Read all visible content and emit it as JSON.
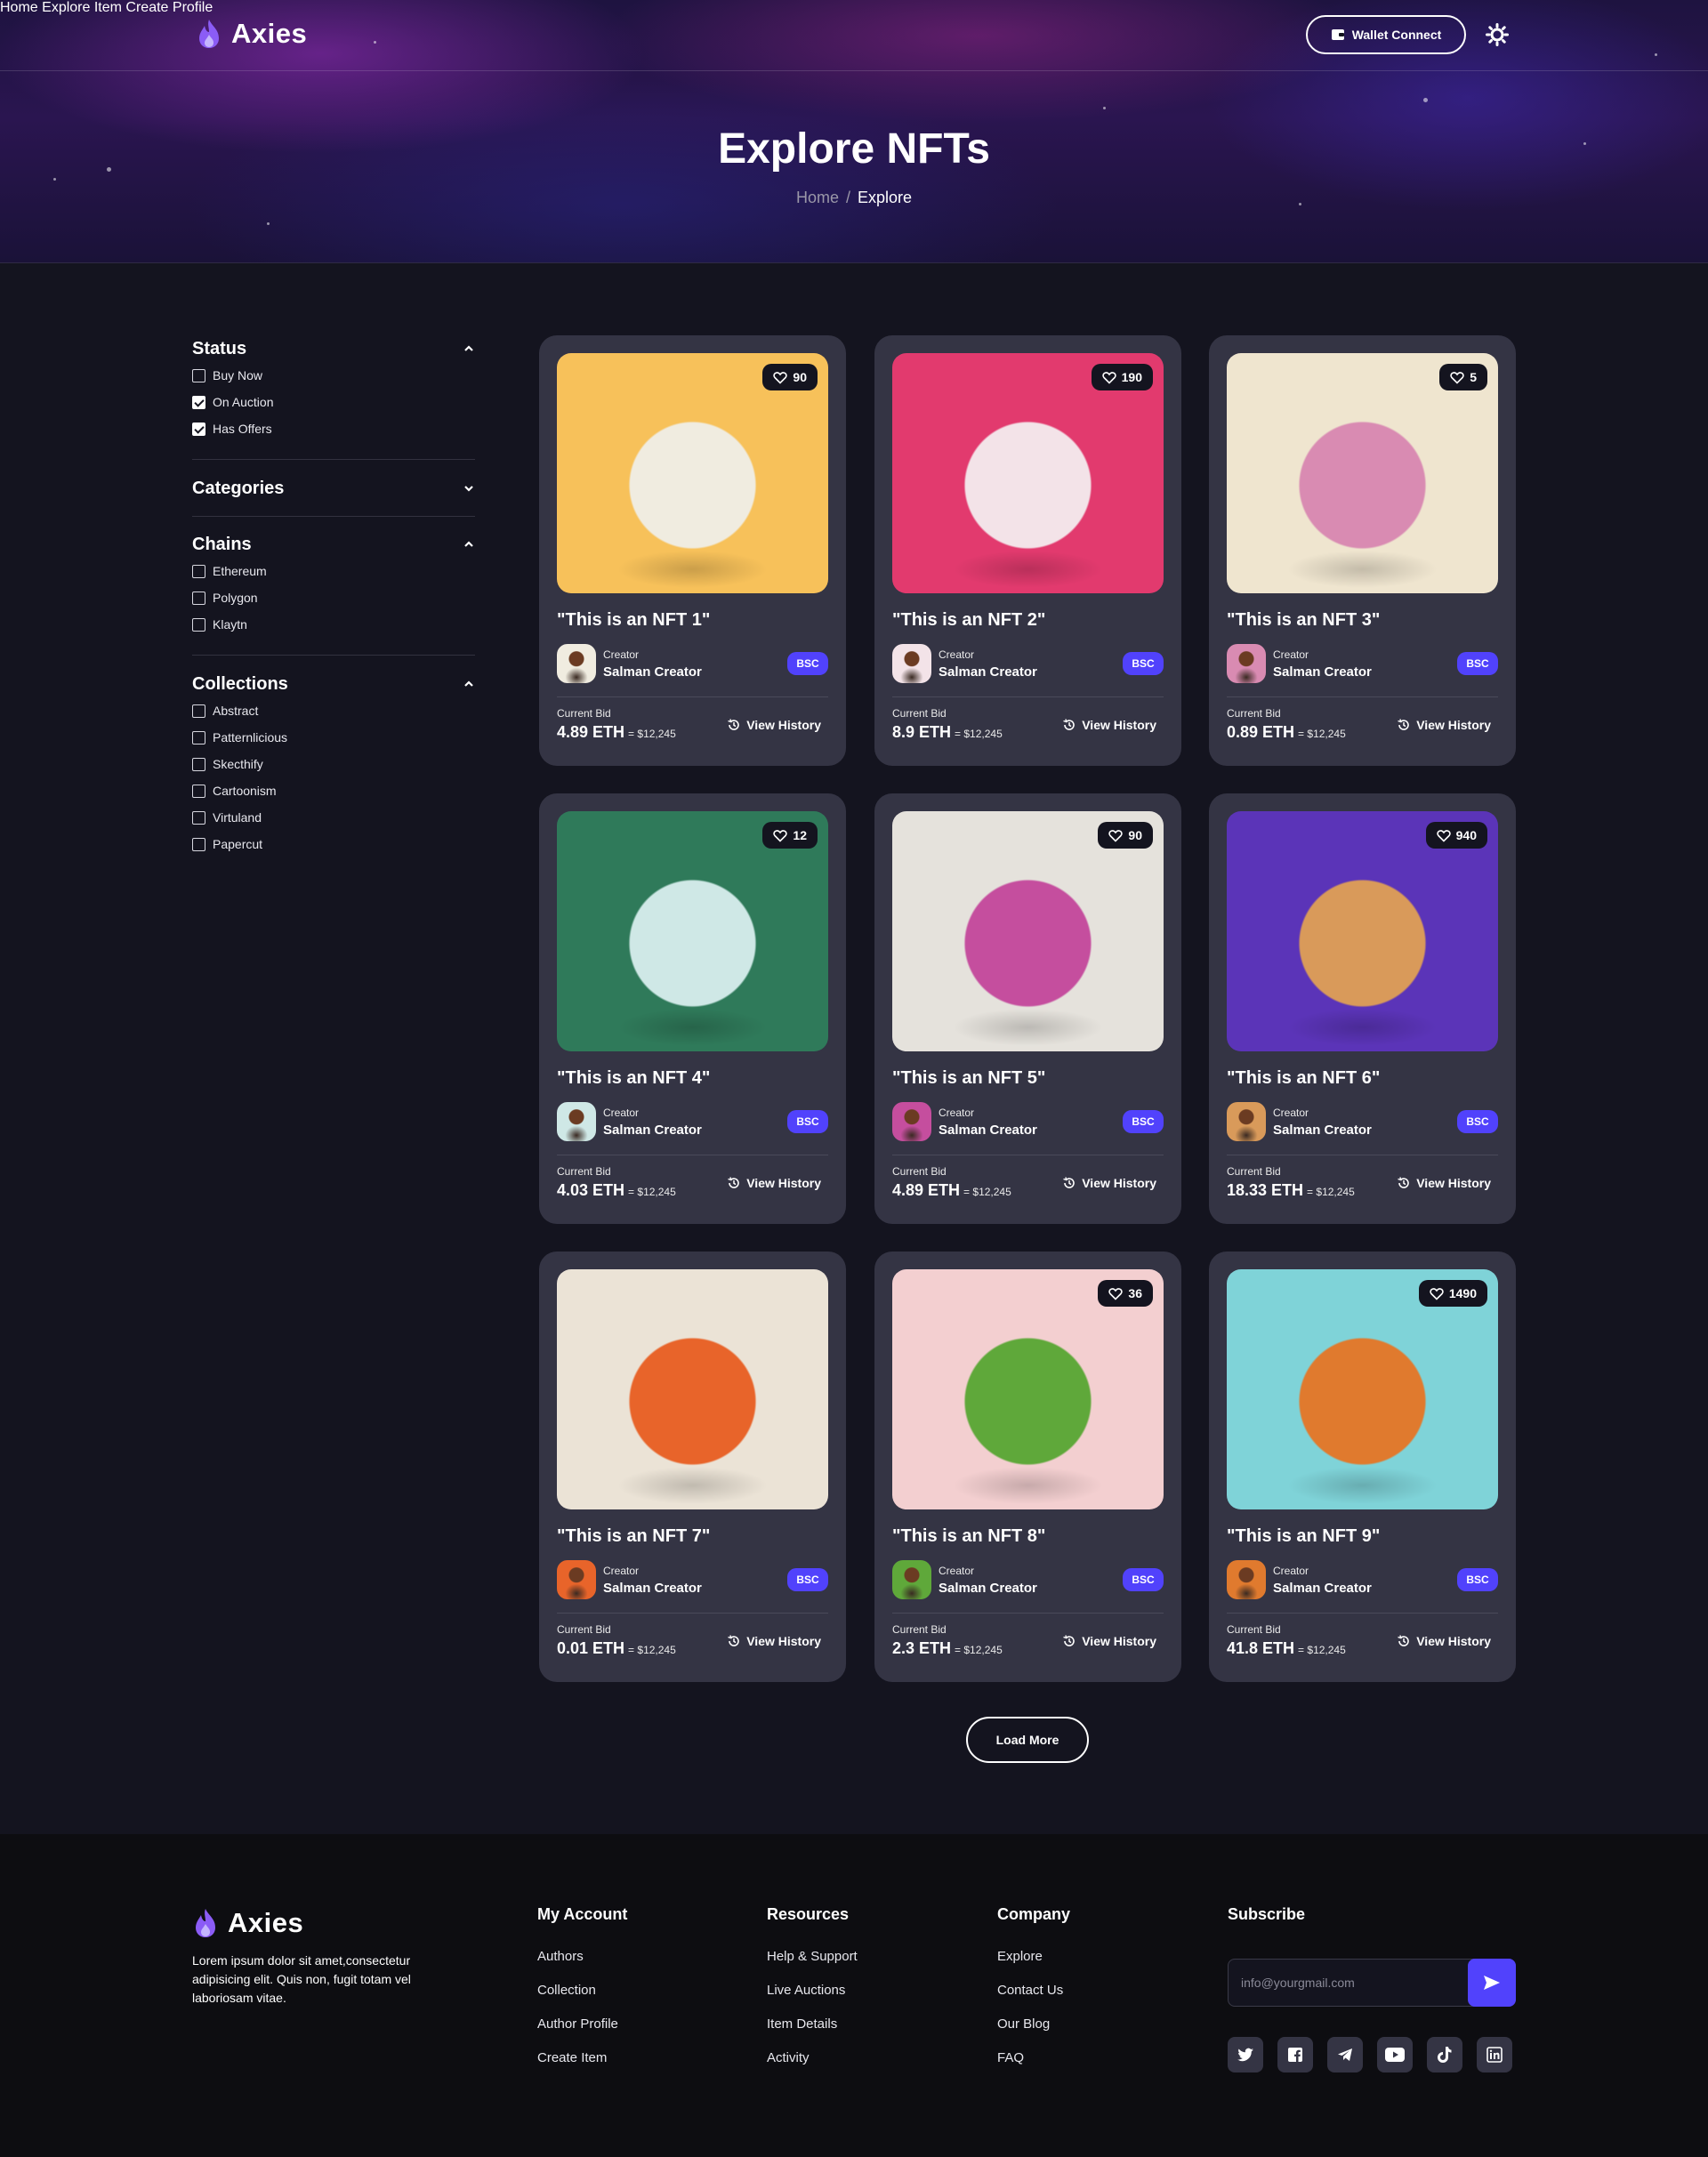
{
  "brand": {
    "name": "Axies"
  },
  "nav": {
    "items": [
      "Home",
      "Explore",
      "Item",
      "Create",
      "Profile"
    ],
    "wallet_label": "Wallet Connect"
  },
  "hero": {
    "title": "Explore NFTs",
    "breadcrumb": {
      "home": "Home",
      "separator": "/",
      "current": "Explore"
    }
  },
  "filters": {
    "status": {
      "title": "Status",
      "expanded": true,
      "options": [
        {
          "label": "Buy Now",
          "checked": false
        },
        {
          "label": "On Auction",
          "checked": true
        },
        {
          "label": "Has Offers",
          "checked": true
        }
      ]
    },
    "categories": {
      "title": "Categories",
      "expanded": false
    },
    "chains": {
      "title": "Chains",
      "expanded": true,
      "options": [
        {
          "label": "Ethereum",
          "checked": false
        },
        {
          "label": "Polygon",
          "checked": false
        },
        {
          "label": "Klaytn",
          "checked": false
        }
      ]
    },
    "collections": {
      "title": "Collections",
      "expanded": true,
      "options": [
        {
          "label": "Abstract",
          "checked": false
        },
        {
          "label": "Patternlicious",
          "checked": false
        },
        {
          "label": "Skecthify",
          "checked": false
        },
        {
          "label": "Cartoonism",
          "checked": false
        },
        {
          "label": "Virtuland",
          "checked": false
        },
        {
          "label": "Papercut",
          "checked": false
        }
      ]
    }
  },
  "card_labels": {
    "creator_label": "Creator",
    "bid_label": "Current Bid",
    "history_label": "View History"
  },
  "cards": [
    {
      "title": "\"This is an NFT 1\"",
      "likes": "90",
      "creator": "Salman Creator",
      "chain": "BSC",
      "bid": "4.89 ETH",
      "usd": "= $12,245",
      "bg": "#f7c15a",
      "accent": "#f0ece0"
    },
    {
      "title": "\"This is an NFT 2\"",
      "likes": "190",
      "creator": "Salman Creator",
      "chain": "BSC",
      "bid": "8.9 ETH",
      "usd": "= $12,245",
      "bg": "#e23a6e",
      "accent": "#f3e3e8"
    },
    {
      "title": "\"This is an NFT 3\"",
      "likes": "5",
      "creator": "Salman Creator",
      "chain": "BSC",
      "bid": "0.89 ETH",
      "usd": "= $12,245",
      "bg": "#efe5cf",
      "accent": "#d98bb2"
    },
    {
      "title": "\"This is an NFT 4\"",
      "likes": "12",
      "creator": "Salman Creator",
      "chain": "BSC",
      "bid": "4.03 ETH",
      "usd": "= $12,245",
      "bg": "#2f7a5a",
      "accent": "#cfe8e6"
    },
    {
      "title": "\"This is an NFT 5\"",
      "likes": "90",
      "creator": "Salman Creator",
      "chain": "BSC",
      "bid": "4.89 ETH",
      "usd": "= $12,245",
      "bg": "#e5e2dc",
      "accent": "#c54e9e"
    },
    {
      "title": "\"This is an NFT 6\"",
      "likes": "940",
      "creator": "Salman Creator",
      "chain": "BSC",
      "bid": "18.33 ETH",
      "usd": "= $12,245",
      "bg": "#5b34b8",
      "accent": "#d99a5a"
    },
    {
      "title": "\"This is an NFT 7\"",
      "likes": "",
      "creator": "Salman Creator",
      "chain": "BSC",
      "bid": "0.01 ETH",
      "usd": "= $12,245",
      "bg": "#ebe3d6",
      "accent": "#e8642a"
    },
    {
      "title": "\"This is an NFT 8\"",
      "likes": "36",
      "creator": "Salman Creator",
      "chain": "BSC",
      "bid": "2.3 ETH",
      "usd": "= $12,245",
      "bg": "#f3cfd0",
      "accent": "#5fa83a"
    },
    {
      "title": "\"This is an NFT 9\"",
      "likes": "1490",
      "creator": "Salman Creator",
      "chain": "BSC",
      "bid": "41.8 ETH",
      "usd": "= $12,245",
      "bg": "#7fd3d8",
      "accent": "#e07a2e"
    }
  ],
  "load_more_label": "Load More",
  "footer": {
    "brand": "Axies",
    "description": "Lorem ipsum dolor sit amet,consectetur adipisicing elit. Quis non, fugit totam vel laboriosam vitae.",
    "columns": [
      {
        "title": "My Account",
        "links": [
          "Authors",
          "Collection",
          "Author Profile",
          "Create Item"
        ]
      },
      {
        "title": "Resources",
        "links": [
          "Help & Support",
          "Live Auctions",
          "Item Details",
          "Activity"
        ]
      },
      {
        "title": "Company",
        "links": [
          "Explore",
          "Contact Us",
          "Our Blog",
          "FAQ"
        ]
      }
    ],
    "subscribe": {
      "title": "Subscribe",
      "placeholder": "info@yourgmail.com"
    },
    "socials": [
      "twitter-icon",
      "facebook-icon",
      "telegram-icon",
      "youtube-icon",
      "tiktok-icon",
      "linkedin-icon"
    ]
  },
  "colors": {
    "accent": "#5142fc",
    "card": "#343444",
    "bg": "#14141f"
  }
}
